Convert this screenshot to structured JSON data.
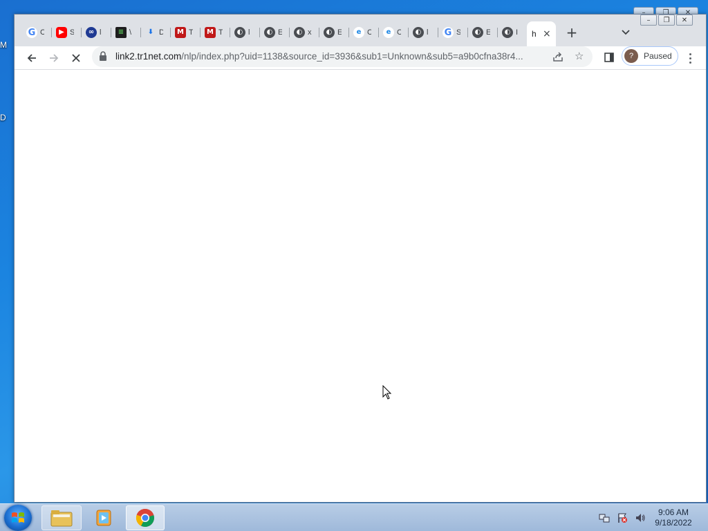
{
  "desktop": {
    "labels": [
      "M",
      "D"
    ]
  },
  "browser": {
    "tabs": [
      {
        "favicon": "google-icon",
        "title": "C"
      },
      {
        "favicon": "youtube-icon",
        "title": "S"
      },
      {
        "favicon": "cluster-icon",
        "title": "l"
      },
      {
        "favicon": "terminal-icon",
        "title": "\\"
      },
      {
        "favicon": "download-icon",
        "title": "D"
      },
      {
        "favicon": "mcafee-icon",
        "title": "T"
      },
      {
        "favicon": "mcafee-icon",
        "title": "T"
      },
      {
        "favicon": "globe-icon",
        "title": "l"
      },
      {
        "favicon": "globe-icon",
        "title": "E"
      },
      {
        "favicon": "globe-icon",
        "title": "x"
      },
      {
        "favicon": "globe-icon",
        "title": "E"
      },
      {
        "favicon": "blue-e-icon",
        "title": "C"
      },
      {
        "favicon": "blue-e-icon",
        "title": "C"
      },
      {
        "favicon": "globe-icon",
        "title": "l"
      },
      {
        "favicon": "google-icon",
        "title": "S"
      },
      {
        "favicon": "globe-icon",
        "title": "E"
      },
      {
        "favicon": "globe-icon",
        "title": "I"
      }
    ],
    "active_tab": {
      "title": "h",
      "close": "×"
    },
    "new_tab": "+",
    "address": {
      "host": "link2.tr1net.com",
      "path": "/nlp/index.php?uid=1138&source_id=3936&sub1=Unknown&sub5=a9b0cfna38r4..."
    },
    "profile": {
      "avatar": "?",
      "label": "Paused"
    },
    "colors": {
      "accent": "#1a73e8",
      "tabstrip": "#dee1e6"
    }
  },
  "taskbar": {
    "clock": {
      "time": "9:06 AM",
      "date": "9/18/2022"
    }
  }
}
